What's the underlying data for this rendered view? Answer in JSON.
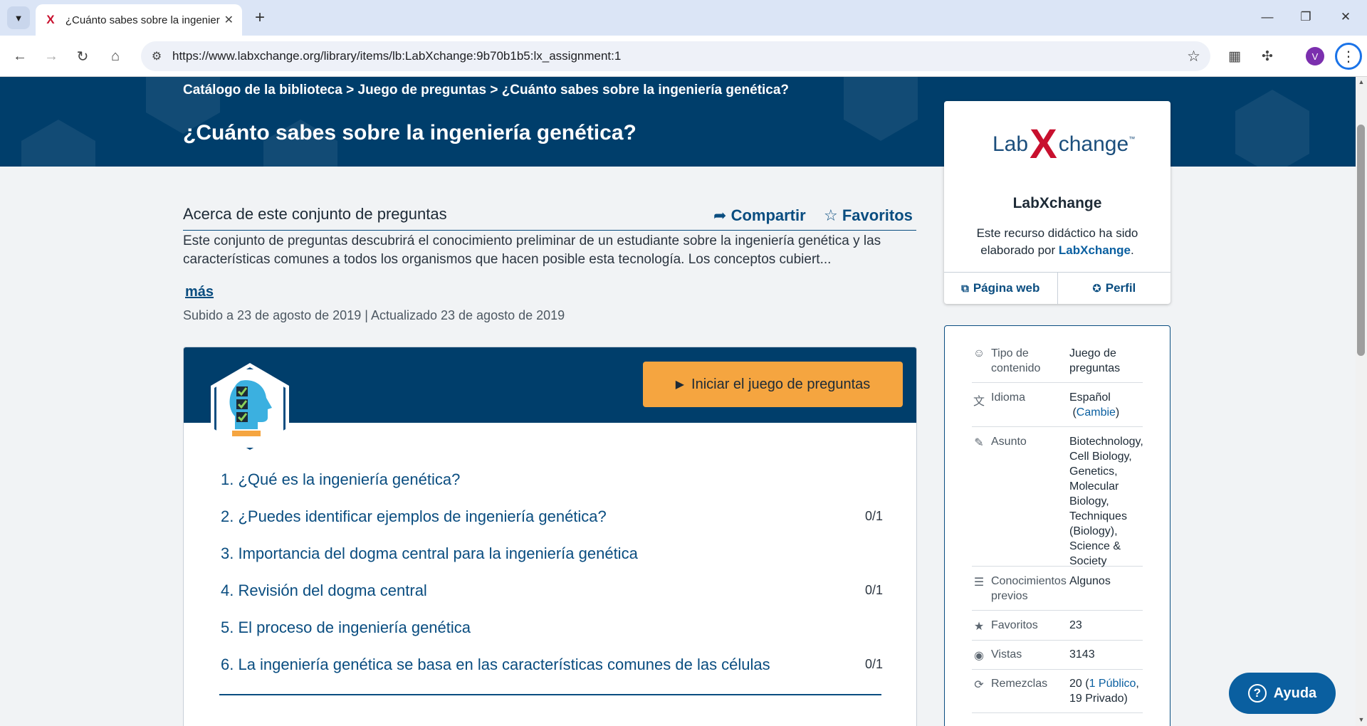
{
  "browser": {
    "tab_title": "¿Cuánto sabes sobre la ingeniería genética?",
    "url": "https://www.labxchange.org/library/items/lb:LabXchange:9b70b1b5:lx_assignment:1",
    "profile_initial": "V",
    "favicon_letter": "X"
  },
  "breadcrumb": {
    "catalog": "Catálogo de la biblioteca",
    "sep1": ">",
    "type": "Juego de preguntas",
    "sep2": ">",
    "current": "¿Cuánto sabes sobre la ingeniería genética?"
  },
  "page_title": "¿Cuánto sabes sobre la ingeniería genética?",
  "about": {
    "heading": "Acerca de este conjunto de preguntas",
    "share": "Compartir",
    "favorite": "Favoritos",
    "description": "Este conjunto de preguntas descubrirá el conocimiento preliminar de un estudiante sobre la ingeniería genética y las características comunes a todos los organismos que hacen posible esta tecnología. Los conceptos cubiert...",
    "more": "más",
    "uploaded": "Subido a 23 de agosto de 2019",
    "date_sep": "|",
    "updated": "Actualizado 23 de agosto de 2019"
  },
  "quiz": {
    "start_button": "Iniciar el juego de preguntas",
    "questions": [
      {
        "label": "1. ¿Qué es la ingeniería genética?",
        "score": ""
      },
      {
        "label": "2. ¿Puedes identificar ejemplos de ingeniería genética?",
        "score": "0/1"
      },
      {
        "label": "3. Importancia del dogma central para la ingeniería genética",
        "score": ""
      },
      {
        "label": "4. Revisión del dogma central",
        "score": "0/1"
      },
      {
        "label": "5. El proceso de ingeniería genética",
        "score": ""
      },
      {
        "label": "6. La ingeniería genética se basa en las características comunes de las células",
        "score": "0/1"
      }
    ]
  },
  "org": {
    "logo_left": "Lab",
    "logo_x": "X",
    "logo_right": "change",
    "logo_tm": "™",
    "name": "LabXchange",
    "desc_prefix": "Este recurso didáctico ha sido elaborado por",
    "desc_link": "LabXchange",
    "desc_suffix": ".",
    "website_btn": "Página web",
    "profile_btn": "Perfil"
  },
  "meta": {
    "content_type_label": "Tipo de contenido",
    "content_type_value": "Juego de preguntas",
    "language_label": "Idioma",
    "language_value": "Español",
    "language_change": "Cambie",
    "subject_label": "Asunto",
    "subject_value": "Biotechnology, Cell Biology, Genetics, Molecular Biology, Techniques (Biology), Science & Society",
    "prior_label": "Conocimientos previos",
    "prior_value": "Algunos",
    "favorites_label": "Favoritos",
    "favorites_value": "23",
    "views_label": "Vistas",
    "views_value": "3143",
    "remixes_label": "Remezclas",
    "remixes_count": "20 (",
    "remixes_public": "1 Público",
    "remixes_private": ", 19 Privado)"
  },
  "help_button": "Ayuda",
  "colors": {
    "hero_bg": "#003e6b",
    "accent_orange": "#f5a540",
    "link_blue": "#0a4d80",
    "brand_red": "#c8102e"
  }
}
